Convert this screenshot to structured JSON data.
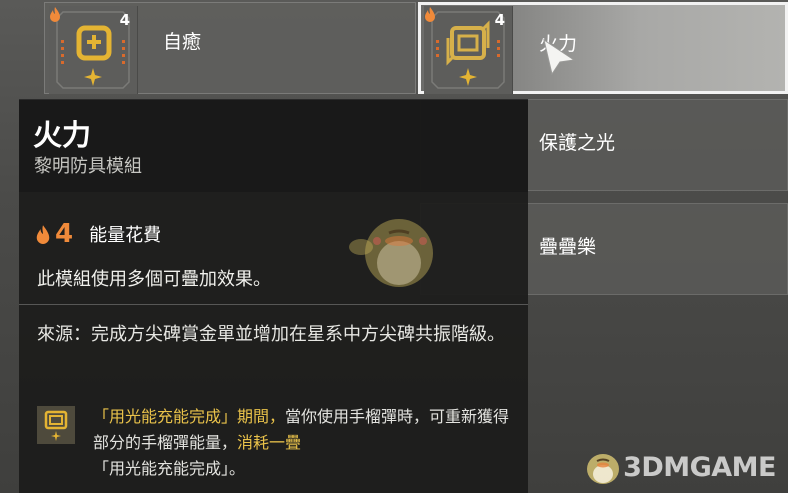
{
  "modules": [
    {
      "name": "自癒",
      "cost": "4"
    },
    {
      "name": "火力",
      "cost": "4",
      "selected": true
    }
  ],
  "dim_rows": [
    {
      "label": "保護之光"
    },
    {
      "label": "疊疊樂"
    }
  ],
  "tooltip": {
    "title": "火力",
    "subtitle": "黎明防具模組",
    "cost_value": "4",
    "cost_label": "能量花費",
    "description": "此模組使用多個可疊加效果。",
    "source": "來源：完成方尖碑賞金單並增加在星系中方尖碑共振階級。",
    "perk": {
      "part1": "「用光能充能完成」期間，",
      "part2": "當你使用手榴彈時，可重新獲得部分的手榴彈能量，",
      "part3": "消耗一疊",
      "part4": "「用光能充能完成」。"
    }
  },
  "watermark": "3DMGAME",
  "colors": {
    "gold": "#e9c24a",
    "flame": "#f08a3a"
  }
}
